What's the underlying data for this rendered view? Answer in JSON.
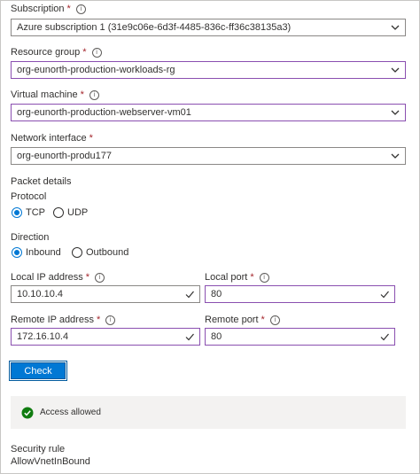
{
  "form": {
    "subscription": {
      "label": "Subscription",
      "value": "Azure subscription 1 (31e9c06e-6d3f-4485-836c-ff36c38135a3)"
    },
    "resource_group": {
      "label": "Resource group",
      "value": "org-eunorth-production-workloads-rg"
    },
    "virtual_machine": {
      "label": "Virtual machine",
      "value": "org-eunorth-production-webserver-vm01"
    },
    "network_interface": {
      "label": "Network interface",
      "value": "org-eunorth-produ177"
    },
    "required_marker": "*",
    "info_glyph": "i"
  },
  "packet": {
    "title": "Packet details",
    "protocol_label": "Protocol",
    "protocol_options": [
      "TCP",
      "UDP"
    ],
    "protocol_selected": "TCP",
    "direction_label": "Direction",
    "direction_options": [
      "Inbound",
      "Outbound"
    ],
    "direction_selected": "Inbound",
    "local_ip": {
      "label": "Local IP address",
      "value": "10.10.10.4"
    },
    "local_port": {
      "label": "Local port",
      "value": "80"
    },
    "remote_ip": {
      "label": "Remote IP address",
      "value": "172.16.10.4"
    },
    "remote_port": {
      "label": "Remote port",
      "value": "80"
    }
  },
  "actions": {
    "check_label": "Check"
  },
  "result": {
    "status": "Access allowed",
    "rule_label": "Security rule",
    "rule_value": "AllowVnetInBound"
  },
  "icons": {
    "dropdown": "chevron-down-icon",
    "valid": "checkmark-icon",
    "info": "info-icon",
    "success": "success-check-icon"
  },
  "colors": {
    "accent": "#0078d4",
    "success": "#107c10",
    "required": "#a4262c",
    "focus_border": "#8a4fb0"
  }
}
